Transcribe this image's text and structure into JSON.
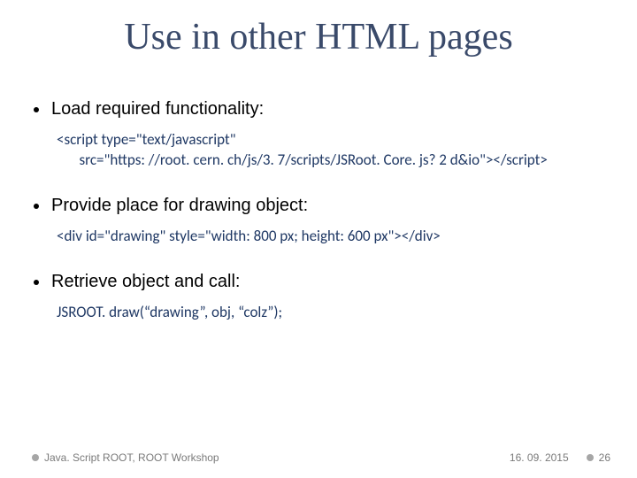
{
  "title": "Use in other HTML pages",
  "bullets": {
    "b1": "Load required functionality:",
    "b2": "Provide place for drawing object:",
    "b3": "Retrieve object and call:"
  },
  "code": {
    "c1": "<script type=\"text/javascript\"\n   src=\"https: //root. cern. ch/js/3. 7/scripts/JSRoot. Core. js? 2 d&io\"></script>",
    "c2": "<div id=\"drawing\" style=\"width: 800 px; height: 600 px\"></div>",
    "c3": "JSROOT. draw(“drawing”, obj, “colz”);"
  },
  "footer": {
    "left": "Java. Script ROOT, ROOT Workshop",
    "date": "16. 09. 2015",
    "page": "26"
  }
}
